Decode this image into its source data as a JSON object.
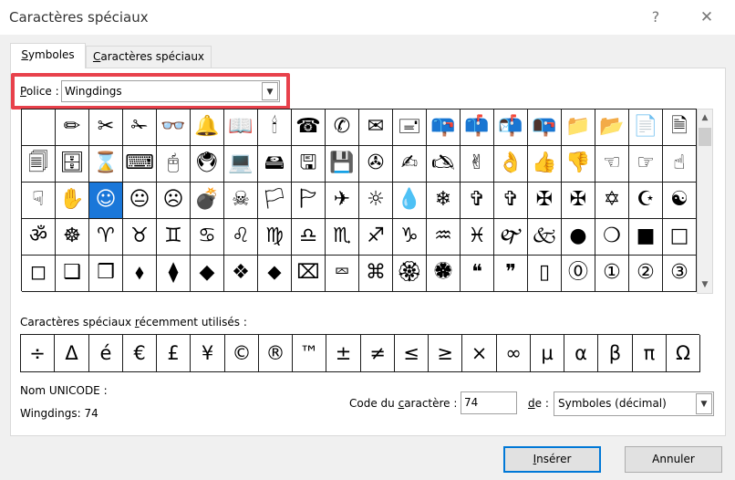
{
  "window": {
    "title": "Caractères spéciaux",
    "help_glyph": "?",
    "close_glyph": "✕"
  },
  "tabs": [
    {
      "label": "Symboles",
      "accel": "S",
      "rest": "ymboles",
      "active": true
    },
    {
      "label": "Caractères spéciaux",
      "accel": "C",
      "rest": "aractères spéciaux",
      "active": false
    }
  ],
  "font": {
    "label": "Police :",
    "accel": "P",
    "rest": "olice :",
    "value": "Wingdings",
    "arrow": "▼",
    "highlight_color": "#e8414b"
  },
  "symbol_grid": {
    "selected_color": "#1a77d9",
    "rows": [
      [
        " ",
        "✏",
        "✂",
        "✁",
        "👓",
        "🔔",
        "📖",
        "🕯",
        "☎",
        "✆",
        "✉",
        "🖃",
        "📪",
        "📫",
        "📬",
        "📭",
        "📁",
        "📂",
        "📄",
        "🗎"
      ],
      [
        "🗐",
        "🗄",
        "⌛",
        "⌨",
        "🖰",
        "🖲",
        "💻",
        "🖴",
        "🖫",
        "💾",
        "✇",
        "✍",
        "🖎",
        "✌",
        "👌",
        "👍",
        "👎",
        "☜",
        "☞",
        "☝"
      ],
      [
        "☟",
        "✋",
        "☺",
        "😐",
        "☹",
        "💣",
        "☠",
        "🏳",
        "🏱",
        "✈",
        "☼",
        "💧",
        "❄",
        "✞",
        "✞",
        "✠",
        "✠",
        "✡",
        "☪",
        "☯"
      ],
      [
        "ॐ",
        "☸",
        "♈",
        "♉",
        "♊",
        "♋",
        "♌",
        "♍",
        "♎",
        "♏",
        "♐",
        "♑",
        "♒",
        "♓",
        "🙰",
        "🙵",
        "●",
        "❍",
        "■",
        "□"
      ],
      [
        "◻",
        "❑",
        "❒",
        "⬧",
        "⧫",
        "◆",
        "❖",
        "⬥",
        "⌧",
        "⮹",
        "⌘",
        "🏵",
        "🏶",
        "❝",
        "❞",
        "▯",
        "⓪",
        "①",
        "②",
        "③"
      ]
    ],
    "selected": {
      "row": 2,
      "col": 2
    }
  },
  "scrollbar": {
    "up": "▲",
    "down": "▼"
  },
  "recent": {
    "label": "Caractères spéciaux récemment utilisés :",
    "label_pre": "Caractères spéciaux ",
    "accel": "r",
    "label_post": "écemment utilisés :",
    "chars": [
      "÷",
      "Δ",
      "é",
      "€",
      "£",
      "¥",
      "©",
      "®",
      "™",
      "±",
      "≠",
      "≤",
      "≥",
      "×",
      "∞",
      "µ",
      "α",
      "β",
      "π",
      "Ω"
    ]
  },
  "unicode": {
    "label": "Nom UNICODE :",
    "value": "Wingdings: 74"
  },
  "code": {
    "label_pre": "Code du ",
    "accel": "c",
    "label_post": "aractère :",
    "value": "74"
  },
  "from": {
    "accel": "d",
    "label_post": "e :",
    "value": "Symboles (décimal)",
    "arrow": "▼"
  },
  "buttons": {
    "insert_accel": "I",
    "insert_rest": "nsérer",
    "cancel": "Annuler"
  }
}
